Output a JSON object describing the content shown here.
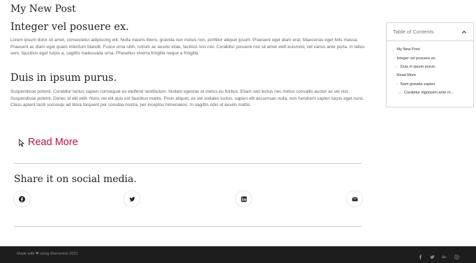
{
  "post": {
    "title": "My New Post",
    "section1_heading": "Integer vel posuere ex.",
    "section1_text": "Lorem ipsum dolor sit amet, consectetur adipiscing elit. Nulla mauris libero, gravida non metus non, porttitor aliquet ipsum. Praesent eget diam erat. Maecenas eget felis massa. Praesent ac diam eget quam interdum blandit. Fusce urna nibh, rutrum ac iaculis vitae, facilisis non nisi. Curabitur posuere nisl sit amet velit euismod, vel varius ante porta. In tellus sem, faucibus eget turpis a, sagittis malesuada urna. Phasellus viverra fringilla neque a fringilla.",
    "section2_heading": "Duis in ipsum purus.",
    "section2_text": "Suspendisse potenti. Curabitur luctus sapien consequat ex eleifend vestibulum. Nullam egestas at metus eu finibus. Etiam sed lectus nec metus convallis auctor ac vel nisl. Suspendisse potenti. Donec id elit velit. Nunc vel elit quis est faucibus mattis. Proin aliquet, ex vel sodales luctus, sapien elit accumsan nulla, non hendrerit sapien turpis eget nunc. Class aptent taciti sociosqu ad litora torquent per conubia nostra, per inceptos himenaeos. In sagittis odio ut iaculis mattis.",
    "read_more_label": "Read More"
  },
  "share": {
    "title": "Share it on social media.",
    "buttons": [
      {
        "icon": "facebook-icon"
      },
      {
        "icon": "twitter-icon"
      },
      {
        "icon": "linkedin-icon"
      },
      {
        "icon": "email-icon"
      }
    ]
  },
  "toc": {
    "title": "Table of Contents",
    "items": [
      {
        "label": "My New Post",
        "level": 0
      },
      {
        "label": "Integer vel posuere ex.",
        "level": 0
      },
      {
        "label": "Duis in ipsum purus.",
        "level": 1
      },
      {
        "label": "Read More",
        "level": 0
      },
      {
        "label": "Nam gravida sapien",
        "level": 1
      },
      {
        "label": "Curabitur dignissim ante m...",
        "level": 2
      }
    ]
  },
  "footer": {
    "text": "Made with ❤ using Elementor 2021",
    "icons": [
      "facebook-icon",
      "twitter-icon",
      "google-plus-icon",
      "pinterest-icon"
    ],
    "background": "#1d1d1d"
  },
  "colors": {
    "accent": "#b5124a",
    "heading": "#222222",
    "body_text": "#666666"
  }
}
